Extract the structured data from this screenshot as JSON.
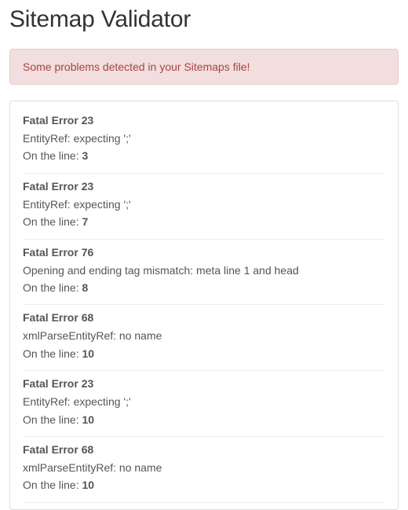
{
  "title": "Sitemap Validator",
  "alert": {
    "text": "Some problems detected in your Sitemaps file!"
  },
  "line_prefix": "On the line: ",
  "errors": [
    {
      "title": "Fatal Error 23",
      "message": "EntityRef: expecting ';'",
      "line": "3"
    },
    {
      "title": "Fatal Error 23",
      "message": "EntityRef: expecting ';'",
      "line": "7"
    },
    {
      "title": "Fatal Error 76",
      "message": "Opening and ending tag mismatch: meta line 1 and head",
      "line": "8"
    },
    {
      "title": "Fatal Error 68",
      "message": "xmlParseEntityRef: no name",
      "line": "10"
    },
    {
      "title": "Fatal Error 23",
      "message": "EntityRef: expecting ';'",
      "line": "10"
    },
    {
      "title": "Fatal Error 68",
      "message": "xmlParseEntityRef: no name",
      "line": "10"
    }
  ]
}
